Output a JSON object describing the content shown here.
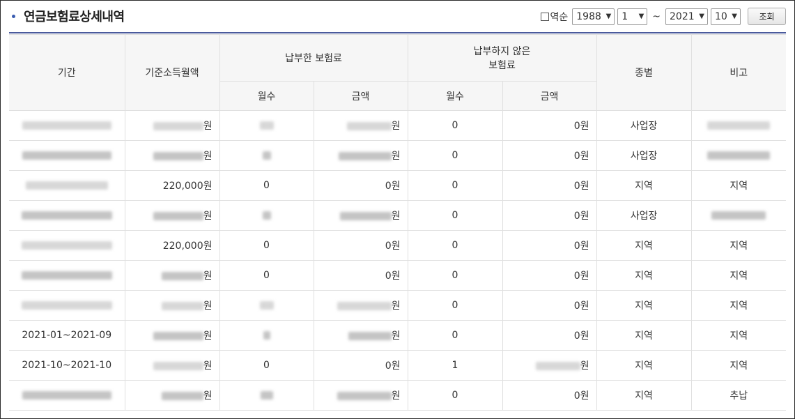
{
  "header": {
    "title": "연금보험료상세내역",
    "reverse_label": "역순",
    "from_year": "1988",
    "from_month": "1",
    "tilde": "~",
    "to_year": "2021",
    "to_month": "10",
    "search_button": "조회"
  },
  "columns": {
    "period": "기간",
    "base_income": "기준소득월액",
    "paid_group": "납부한 보험료",
    "unpaid_group_line1": "납부하지 않은",
    "unpaid_group_line2": "보험료",
    "type": "종별",
    "note": "비고",
    "months": "월수",
    "amount": "금액"
  },
  "rows": [
    {
      "period": "",
      "base_income": "원",
      "paid_months": "",
      "paid_amount": "원",
      "unpaid_months": "0",
      "unpaid_amount": "0원",
      "type": "사업장",
      "note": ""
    },
    {
      "period": "",
      "base_income": "원",
      "paid_months": "",
      "paid_amount": "원",
      "unpaid_months": "0",
      "unpaid_amount": "0원",
      "type": "사업장",
      "note": ""
    },
    {
      "period": "",
      "base_income": "220,000원",
      "paid_months": "0",
      "paid_amount": "0원",
      "unpaid_months": "0",
      "unpaid_amount": "0원",
      "type": "지역",
      "note": "지역"
    },
    {
      "period": "",
      "base_income": "원",
      "paid_months": "",
      "paid_amount": "원",
      "unpaid_months": "0",
      "unpaid_amount": "0원",
      "type": "사업장",
      "note": ""
    },
    {
      "period": "",
      "base_income": "220,000원",
      "paid_months": "0",
      "paid_amount": "0원",
      "unpaid_months": "0",
      "unpaid_amount": "0원",
      "type": "지역",
      "note": "지역"
    },
    {
      "period": "",
      "base_income": "원",
      "paid_months": "0",
      "paid_amount": "0원",
      "unpaid_months": "0",
      "unpaid_amount": "0원",
      "type": "지역",
      "note": "지역"
    },
    {
      "period": "",
      "base_income": "원",
      "paid_months": "",
      "paid_amount": "원",
      "unpaid_months": "0",
      "unpaid_amount": "0원",
      "type": "지역",
      "note": "지역"
    },
    {
      "period": "2021-01~2021-09",
      "base_income": "원",
      "paid_months": "",
      "paid_amount": "원",
      "unpaid_months": "0",
      "unpaid_amount": "0원",
      "type": "지역",
      "note": "지역"
    },
    {
      "period": "2021-10~2021-10",
      "base_income": "원",
      "paid_months": "0",
      "paid_amount": "0원",
      "unpaid_months": "1",
      "unpaid_amount": "원",
      "type": "지역",
      "note": "지역"
    },
    {
      "period": "",
      "base_income": "원",
      "paid_months": "",
      "paid_amount": "원",
      "unpaid_months": "0",
      "unpaid_amount": "0원",
      "type": "지역",
      "note": "추납"
    }
  ]
}
